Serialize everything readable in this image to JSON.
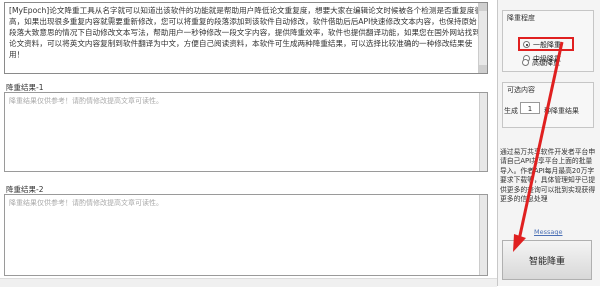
{
  "input": {
    "text": "[MyEpoch]论文降重工具从名字就可以知道出该软件的功能就是帮助用户降低论文重复度，想要大家在编辑论文时候被各个检测是否重复度很高，如果出现很多重复内容就需要重新修改，您可以将重复的段落添加到该软件自动修改，软件借助后后API快速修改文本内容，也保持原始段落大致意思的情况下自动修改文本写法，帮助用户一秒钟修改一段文字内容，提供降重效率，软件也提供翻译功能，如果您在国外网站找到论文资料，可以将英文内容复制到软件翻译为中文，方便自己阅读资料，本软件可生成两种降重结果，可以选择比较准确的一种修改结果使用！"
  },
  "results": [
    {
      "title": "降重结果-1",
      "placeholder": "降重结果仅供参考！请酌情修改提高文章可读性。"
    },
    {
      "title": "降重结果-2",
      "placeholder": "降重结果仅供参考！请酌情修改提高文章可读性。"
    }
  ],
  "settings": {
    "degree_title": "降重程度",
    "options": [
      {
        "label": "一般降重",
        "selected": true
      },
      {
        "label": "中级降重",
        "selected": false
      },
      {
        "label": "高级降重",
        "selected": false
      }
    ],
    "optional_title": "可选内容",
    "quantity_label": "生成",
    "quantity_value": "1",
    "quantity_unit": "种降重结果",
    "description": "通过易万共享软件开发者平台申请自己API共享平台上面的批量导入。作者API每月最高20万字要求下载等，具体管理知乎已提供更多的查询可以批到实现获得更多的信息处理",
    "link": "Message",
    "action_button": "智能降重"
  },
  "colors": {
    "highlight": "#e02020",
    "arrow": "#e02020"
  }
}
